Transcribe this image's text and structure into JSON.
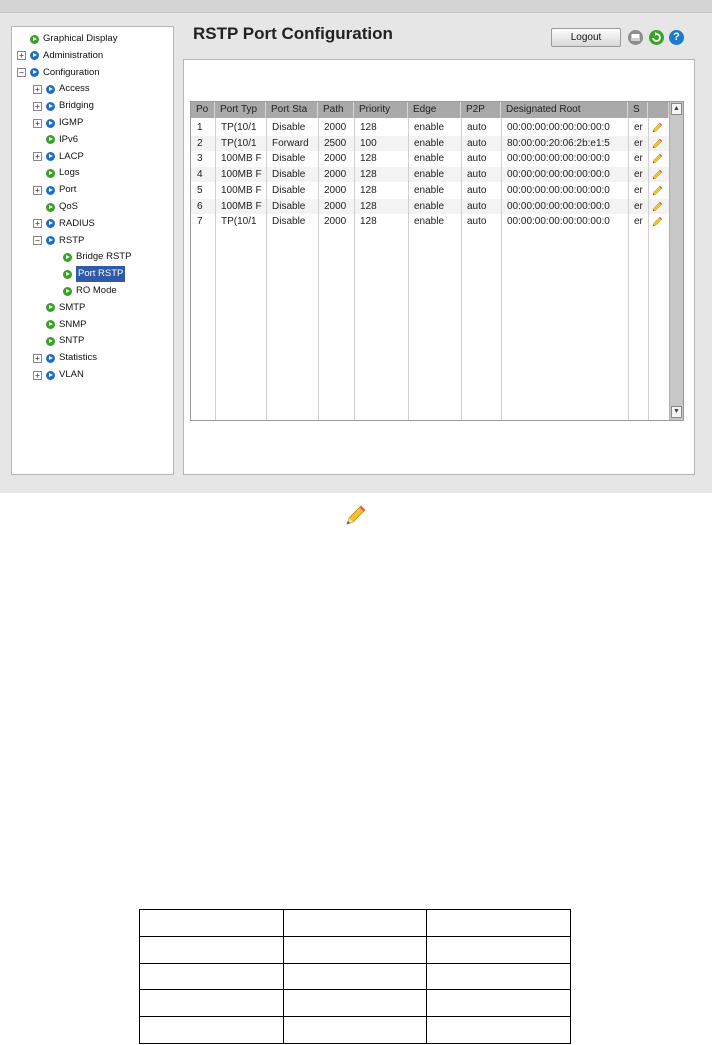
{
  "page": {
    "title": "RSTP Port Configuration"
  },
  "header": {
    "logout_label": "Logout",
    "icons": [
      "print-icon",
      "refresh-icon",
      "help-icon"
    ],
    "help_glyph": "?"
  },
  "sidebar": {
    "items": [
      {
        "label": "Graphical Display",
        "level": 0,
        "expander": "",
        "dot": "green"
      },
      {
        "label": "Administration",
        "level": 0,
        "expander": "+",
        "dot": "blue"
      },
      {
        "label": "Configuration",
        "level": 0,
        "expander": "−",
        "dot": "blue"
      },
      {
        "label": "Access",
        "level": 1,
        "expander": "+",
        "dot": "blue"
      },
      {
        "label": "Bridging",
        "level": 1,
        "expander": "+",
        "dot": "blue"
      },
      {
        "label": "IGMP",
        "level": 1,
        "expander": "+",
        "dot": "blue"
      },
      {
        "label": "IPv6",
        "level": 1,
        "expander": "",
        "dot": "green"
      },
      {
        "label": "LACP",
        "level": 1,
        "expander": "+",
        "dot": "blue"
      },
      {
        "label": "Logs",
        "level": 1,
        "expander": "",
        "dot": "green"
      },
      {
        "label": "Port",
        "level": 1,
        "expander": "+",
        "dot": "blue"
      },
      {
        "label": "QoS",
        "level": 1,
        "expander": "",
        "dot": "green"
      },
      {
        "label": "RADIUS",
        "level": 1,
        "expander": "+",
        "dot": "blue"
      },
      {
        "label": "RSTP",
        "level": 1,
        "expander": "−",
        "dot": "blue"
      },
      {
        "label": "Bridge RSTP",
        "level": 2,
        "expander": "",
        "dot": "green"
      },
      {
        "label": "Port RSTP",
        "level": 2,
        "expander": "",
        "dot": "green",
        "selected": true
      },
      {
        "label": "RO Mode",
        "level": 2,
        "expander": "",
        "dot": "green"
      },
      {
        "label": "SMTP",
        "level": 1,
        "expander": "",
        "dot": "green"
      },
      {
        "label": "SNMP",
        "level": 1,
        "expander": "",
        "dot": "green"
      },
      {
        "label": "SNTP",
        "level": 1,
        "expander": "",
        "dot": "green"
      },
      {
        "label": "Statistics",
        "level": 1,
        "expander": "+",
        "dot": "blue"
      },
      {
        "label": "VLAN",
        "level": 1,
        "expander": "+",
        "dot": "blue"
      }
    ]
  },
  "table": {
    "columns": [
      "Po",
      "Port Typ",
      "Port Sta",
      "Path",
      "Priority",
      "Edge",
      "P2P",
      "Designated Root",
      "S",
      ""
    ],
    "rows": [
      [
        "1",
        "TP(10/1",
        "Disable",
        "2000",
        "128",
        "enable",
        "auto",
        "00:00:00:00:00:00:00:0",
        "er"
      ],
      [
        "2",
        "TP(10/1",
        "Forward",
        "2500",
        "100",
        "enable",
        "auto",
        "80:00:00:20:06:2b:e1:5",
        "er"
      ],
      [
        "3",
        "100MB F",
        "Disable",
        "2000",
        "128",
        "enable",
        "auto",
        "00:00:00:00:00:00:00:0",
        "er"
      ],
      [
        "4",
        "100MB F",
        "Disable",
        "2000",
        "128",
        "enable",
        "auto",
        "00:00:00:00:00:00:00:0",
        "er"
      ],
      [
        "5",
        "100MB F",
        "Disable",
        "2000",
        "128",
        "enable",
        "auto",
        "00:00:00:00:00:00:00:0",
        "er"
      ],
      [
        "6",
        "100MB F",
        "Disable",
        "2000",
        "128",
        "enable",
        "auto",
        "00:00:00:00:00:00:00:0",
        "er"
      ],
      [
        "7",
        "TP(10/1",
        "Disable",
        "2000",
        "128",
        "enable",
        "auto",
        "00:00:00:00:00:00:00:0",
        "er"
      ]
    ],
    "row_icon": "edit-pencil-icon",
    "scroll_up_glyph": "▲",
    "scroll_down_glyph": "▼"
  },
  "annotation_icon": "edit-pencil-icon",
  "bottom_table": {
    "rows": 5,
    "cols": 3
  },
  "colors": {
    "accent": "#2f5aa8",
    "green": "#38a024",
    "blue": "#1f6fc4"
  }
}
